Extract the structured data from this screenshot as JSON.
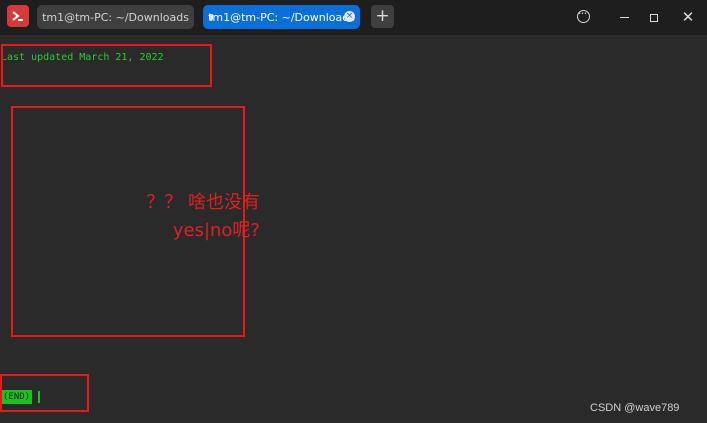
{
  "tabs": [
    {
      "label": "tm1@tm-PC: ~/Downloads",
      "active": false
    },
    {
      "label": "tm1@tm-PC: ~/Downloads",
      "active": true
    }
  ],
  "add_tab_label": "+",
  "window_controls": {
    "close_label": "✕"
  },
  "terminal": {
    "line_1": "Last updated March 21, 2022",
    "end_prompt": "(END)"
  },
  "annotation": {
    "line_1": "？？ 啥也没有",
    "line_2": "yes|no呢?"
  },
  "watermark": "CSDN @wave789",
  "icons": [
    "terminal-app-icon",
    "tab-close-icon",
    "menu-icon",
    "minimize-icon",
    "maximize-icon",
    "close-icon"
  ],
  "colors": {
    "titlebar": "#1e1e1e",
    "terminal_bg": "#2a2a2a",
    "active_tab": "#0a6fd8",
    "terminal_text": "#2fc92f",
    "annotation_red": "#e61a1a"
  }
}
